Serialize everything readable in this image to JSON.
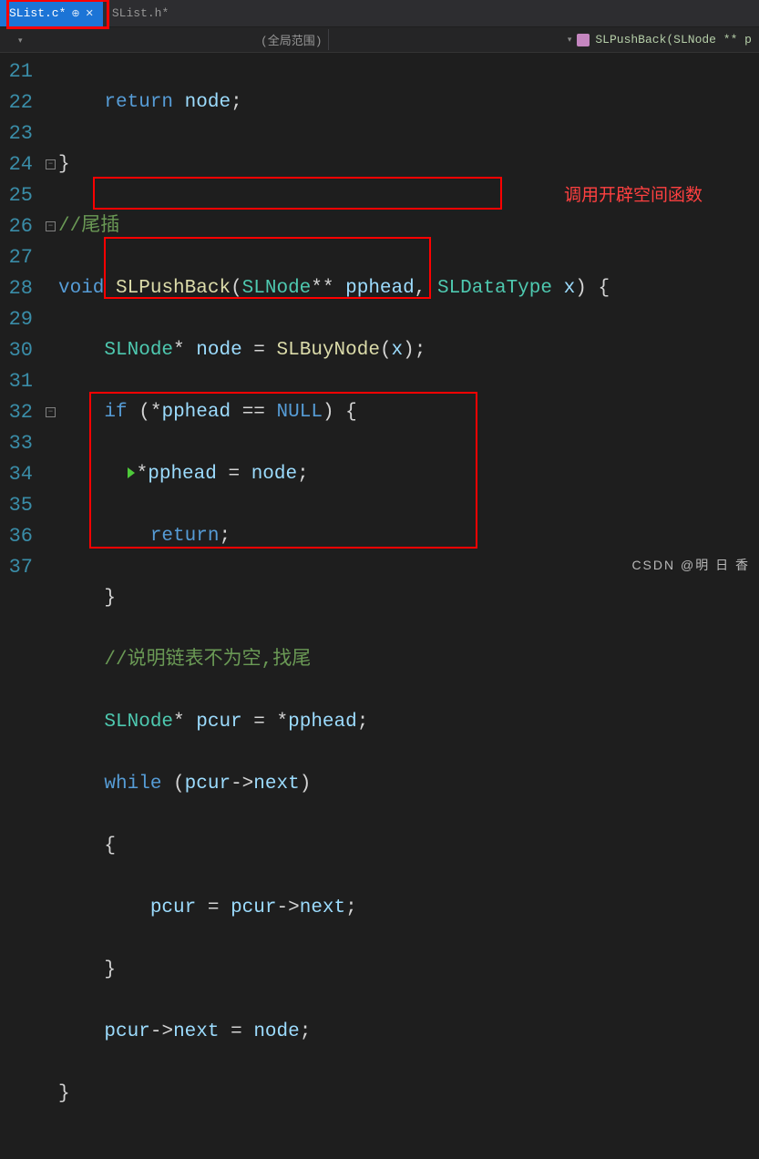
{
  "tabs": {
    "active": {
      "label": "SList.c*"
    },
    "other": {
      "label": "SList.h*"
    }
  },
  "context": {
    "scope_label": "(全局范围)",
    "func_label": "SLPushBack(SLNode ** p"
  },
  "gutter": {
    "start": 21,
    "count": 17
  },
  "code": {
    "l21": {
      "kw": "return",
      "id": "node",
      "end": ";"
    },
    "l22": {
      "brace": "}"
    },
    "l23": {
      "comment": "//尾插"
    },
    "l24": {
      "kw": "void",
      "fn": "SLPushBack",
      "p": "(",
      "ty": "SLNode",
      "st": "**",
      "a1": "pphead",
      "c": ",",
      "ty2": "SLDataType",
      "a2": "x",
      "pc": ")",
      "br": "{"
    },
    "l25": {
      "ty": "SLNode",
      "st": "*",
      "id": "node",
      "eq": "=",
      "fn": "SLBuyNode",
      "p": "(",
      "arg": "x",
      "pc": ")",
      "sc": ";"
    },
    "l26": {
      "kw": "if",
      "p": "(",
      "st": "*",
      "id": "pphead",
      "eq": "==",
      "nul": "NULL",
      "pc": ")",
      "br": "{"
    },
    "l27": {
      "st": "*",
      "id": "pphead",
      "eq": "=",
      "id2": "node",
      "sc": ";"
    },
    "l28": {
      "kw": "return",
      "sc": ";"
    },
    "l29": {
      "brace": "}"
    },
    "l30": {
      "comment": "//说明链表不为空,找尾"
    },
    "l31": {
      "ty": "SLNode",
      "st": "*",
      "id": "pcur",
      "eq": "=",
      "st2": "*",
      "id2": "pphead",
      "sc": ";"
    },
    "l32": {
      "kw": "while",
      "p": "(",
      "id": "pcur",
      "ar": "->",
      "id2": "next",
      "pc": ")"
    },
    "l33": {
      "brace": "{"
    },
    "l34": {
      "id": "pcur",
      "eq": "=",
      "id2": "pcur",
      "ar": "->",
      "id3": "next",
      "sc": ";"
    },
    "l35": {
      "brace": "}"
    },
    "l36": {
      "id": "pcur",
      "ar": "->",
      "id2": "next",
      "eq": "=",
      "id3": "node",
      "sc": ";"
    },
    "l37": {
      "brace": "}"
    }
  },
  "annotation": {
    "text": "调用开辟空间函数"
  },
  "watermark": {
    "text": "CSDN @明 日 香"
  }
}
